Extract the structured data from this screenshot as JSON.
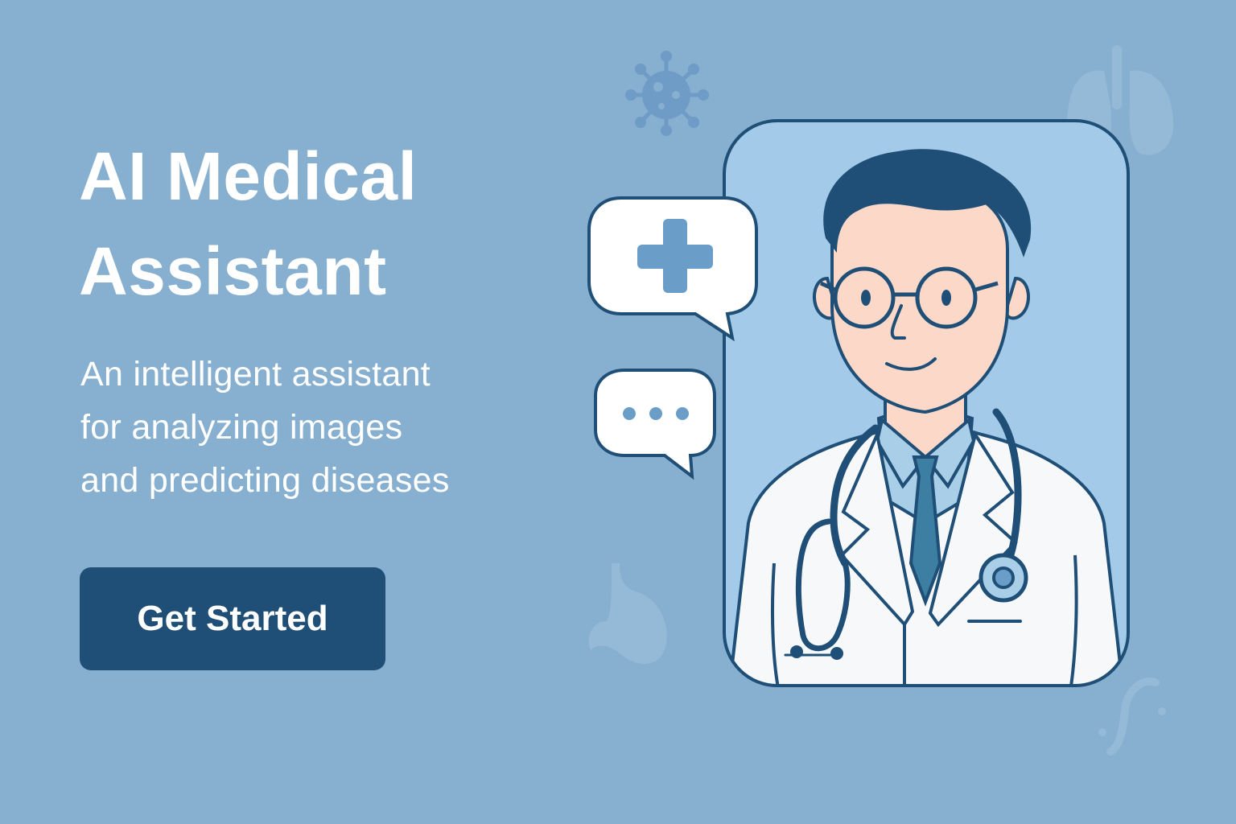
{
  "hero": {
    "title_lines": [
      "AI Medical",
      "Assistant"
    ],
    "subtitle_lines": [
      "An intelligent assistant",
      "for analyzing images",
      "and predicting diseases"
    ],
    "cta_label": "Get Started"
  },
  "colors": {
    "background": "#86afd0",
    "button": "#1f4f76",
    "card": "#a3cae8",
    "outline": "#1f4f76",
    "coat": "#f6f8fa",
    "skin": "#fbd8c8",
    "hair": "#1f4f76",
    "tie": "#3c7fa2",
    "shirt": "#a9cfe8",
    "bubble_icon": "#6a9ec8",
    "decor": "#6f9cc6"
  },
  "icons": [
    "virus-icon",
    "lungs-icon",
    "stomach-icon",
    "kidney-icon",
    "medical-cross-icon",
    "typing-dots-icon",
    "stethoscope-icon"
  ]
}
